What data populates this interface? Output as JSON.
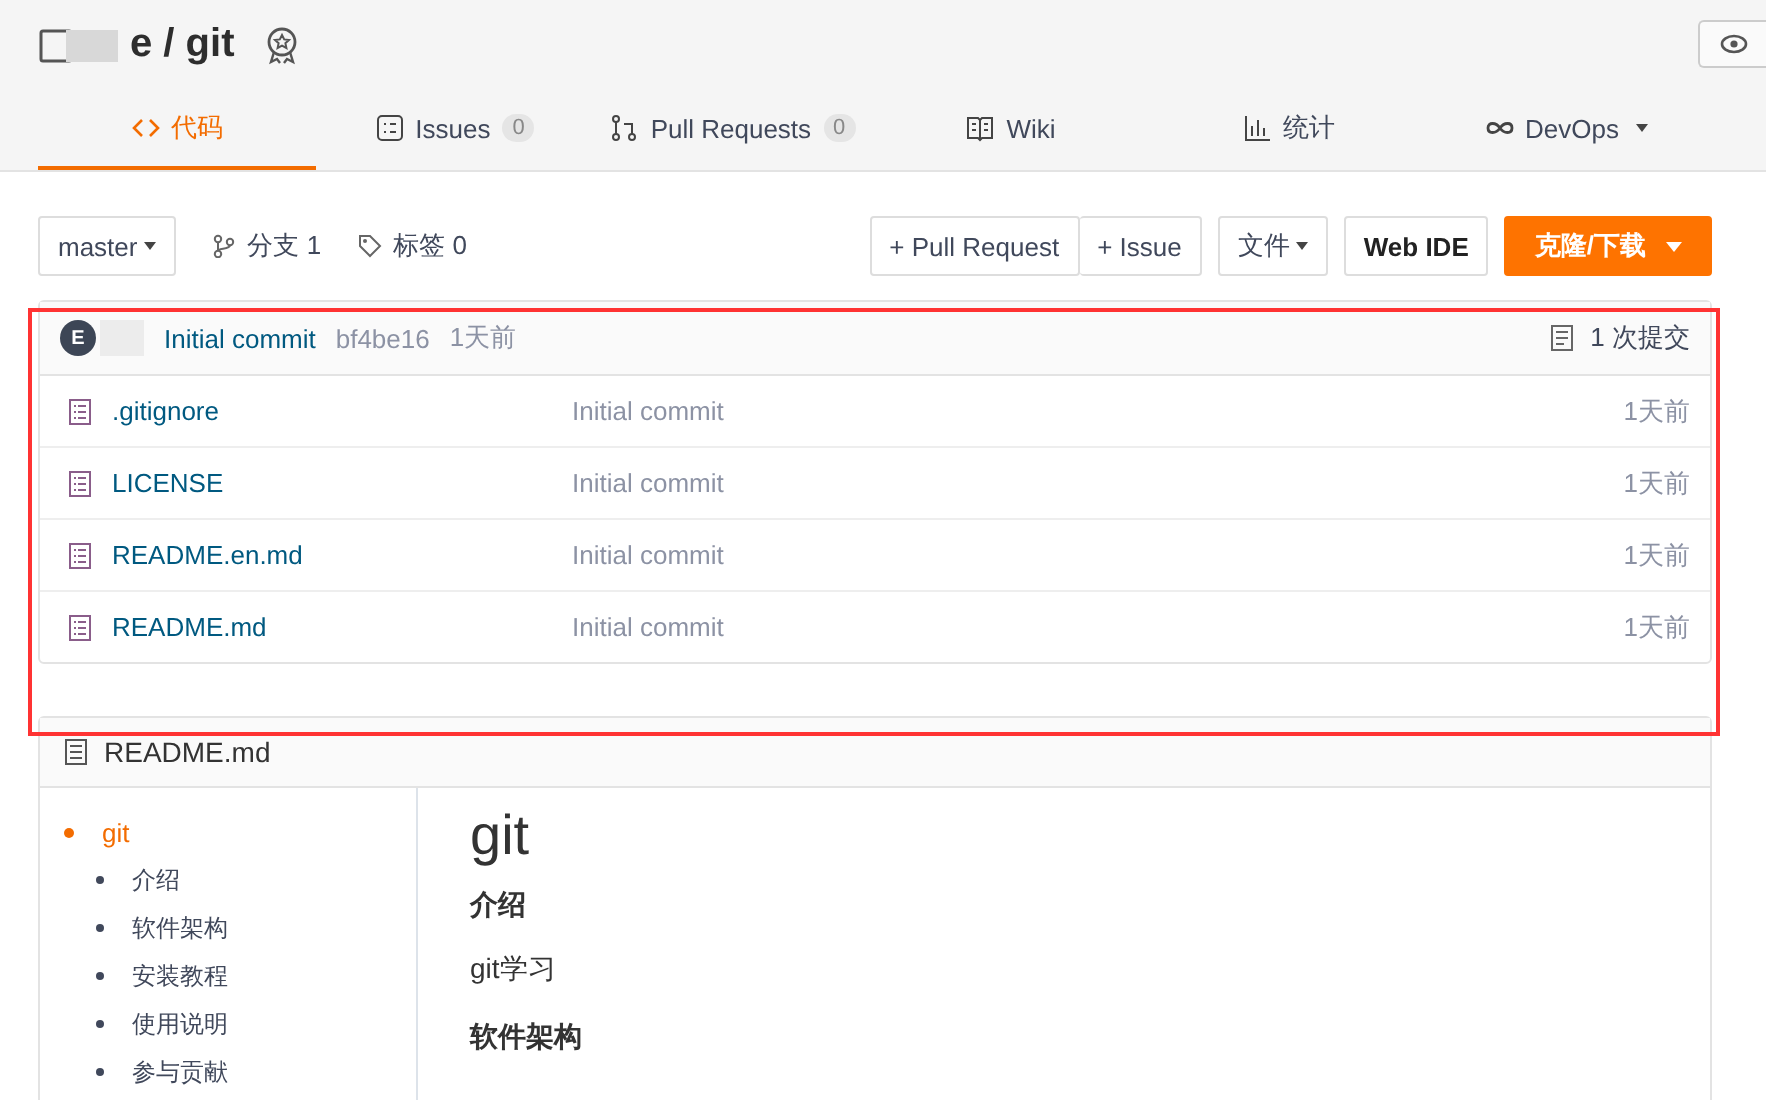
{
  "repo": {
    "title": "e / git"
  },
  "tabs": [
    {
      "label": "代码",
      "selected": true
    },
    {
      "label": "Issues",
      "count": "0",
      "selected": false
    },
    {
      "label": "Pull Requests",
      "count": "0",
      "selected": false
    },
    {
      "label": "Wiki",
      "selected": false
    },
    {
      "label": "统计",
      "selected": false
    },
    {
      "label": "DevOps",
      "dropdown": true,
      "selected": false
    }
  ],
  "toolbar": {
    "branch": "master",
    "branches": "分支 1",
    "tags": "标签 0",
    "pull_request": "+ Pull Request",
    "issue": "+ Issue",
    "files": "文件",
    "web_ide": "Web IDE",
    "clone": "克隆/下载"
  },
  "commit": {
    "avatar": "E",
    "message": "Initial commit",
    "hash": "bf4be16",
    "time": "1天前",
    "count": "1 次提交"
  },
  "files": [
    {
      "name": ".gitignore",
      "commit": "Initial commit",
      "time": "1天前"
    },
    {
      "name": "LICENSE",
      "commit": "Initial commit",
      "time": "1天前"
    },
    {
      "name": "README.en.md",
      "commit": "Initial commit",
      "time": "1天前"
    },
    {
      "name": "README.md",
      "commit": "Initial commit",
      "time": "1天前"
    }
  ],
  "readme": {
    "filename": "README.md",
    "toc": [
      {
        "label": "git",
        "selected": true,
        "children": [
          {
            "label": "介绍",
            "selected": false
          },
          {
            "label": "软件架构",
            "selected": false
          },
          {
            "label": "安装教程",
            "selected": false
          },
          {
            "label": "使用说明",
            "selected": false
          },
          {
            "label": "参与贡献",
            "selected": false
          }
        ]
      }
    ],
    "content": [
      {
        "kind": "title",
        "text": "git"
      },
      {
        "kind": "heading",
        "text": "介绍"
      },
      {
        "kind": "paragraph",
        "text": "git学习"
      },
      {
        "kind": "heading",
        "text": "软件架构"
      }
    ]
  }
}
